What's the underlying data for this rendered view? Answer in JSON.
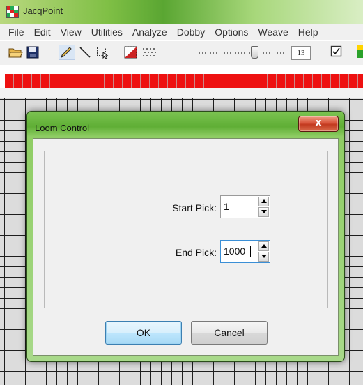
{
  "app": {
    "title": "JacqPoint"
  },
  "menubar": {
    "items": [
      "File",
      "Edit",
      "View",
      "Utilities",
      "Analyze",
      "Dobby",
      "Options",
      "Weave",
      "Help"
    ]
  },
  "toolbar": {
    "icons": [
      "open-folder-icon",
      "save-icon",
      "pencil-icon",
      "line-icon",
      "select-icon",
      "pattern-icon",
      "dots-icon"
    ],
    "zoom_value": "13"
  },
  "dialog": {
    "title": "Loom Control",
    "close_label": "x",
    "start_pick": {
      "label": "Start Pick:",
      "value": "1"
    },
    "end_pick": {
      "label": "End Pick:",
      "value": "1000"
    },
    "ok_label": "OK",
    "cancel_label": "Cancel"
  },
  "colors": {
    "title_bar": "#7fbf45",
    "red_strip": "#ee1111",
    "default_button": "#bee6fd",
    "close_button": "#c23a1f"
  }
}
